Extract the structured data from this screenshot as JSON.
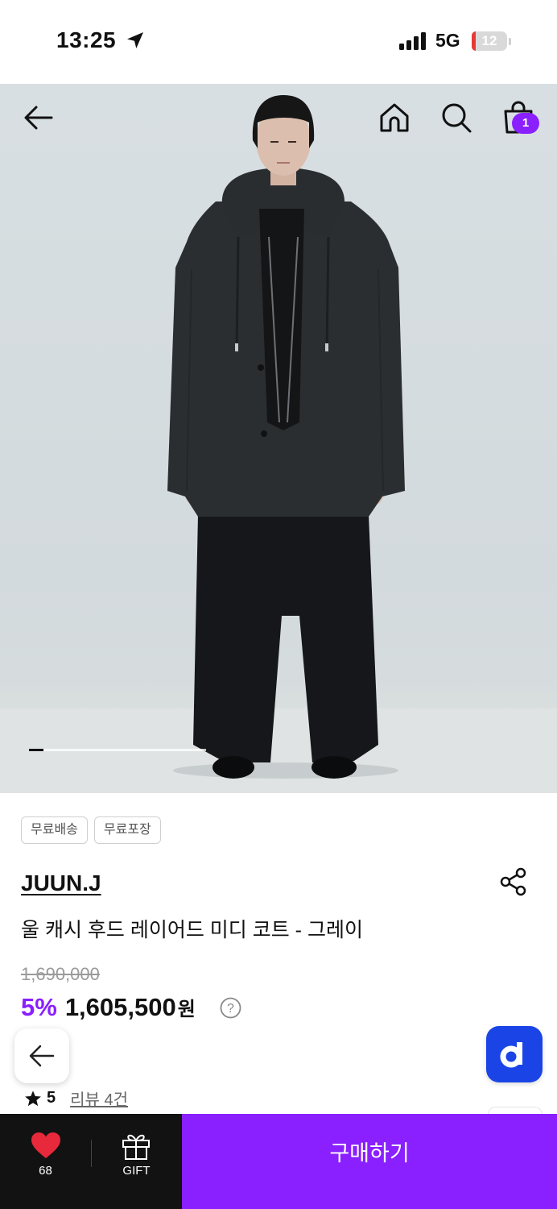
{
  "status_bar": {
    "time": "13:25",
    "network": "5G",
    "battery_level": "12",
    "battery_fraction": 0.12
  },
  "hero": {
    "image_progress": 0.08,
    "cart_badge_count": "1",
    "background_color": "#d6dde0"
  },
  "product": {
    "tags": [
      "무료배송",
      "무료포장"
    ],
    "brand": "JUUN.J",
    "title": "울 캐시 후드 레이어드 미디 코트 - 그레이",
    "original_price": "1,690,000",
    "discount": "5%",
    "price": "1,605,500",
    "currency": "원",
    "rating": "5",
    "review_link": "리뷰 4건"
  },
  "bottom_bar": {
    "like_count": "68",
    "gift_label": "GIFT",
    "buy_label": "구매하기"
  },
  "colors": {
    "accent": "#8a1fff",
    "floating_button": "#1a44e6",
    "heart": "#e8293b",
    "dark_bar": "#121212"
  },
  "icons": [
    "location-arrow-icon",
    "signal-icon",
    "back-arrow-icon",
    "home-icon",
    "search-icon",
    "cart-icon",
    "share-icon",
    "help-icon",
    "star-icon",
    "heart-icon",
    "gift-icon",
    "d-logo-icon"
  ]
}
